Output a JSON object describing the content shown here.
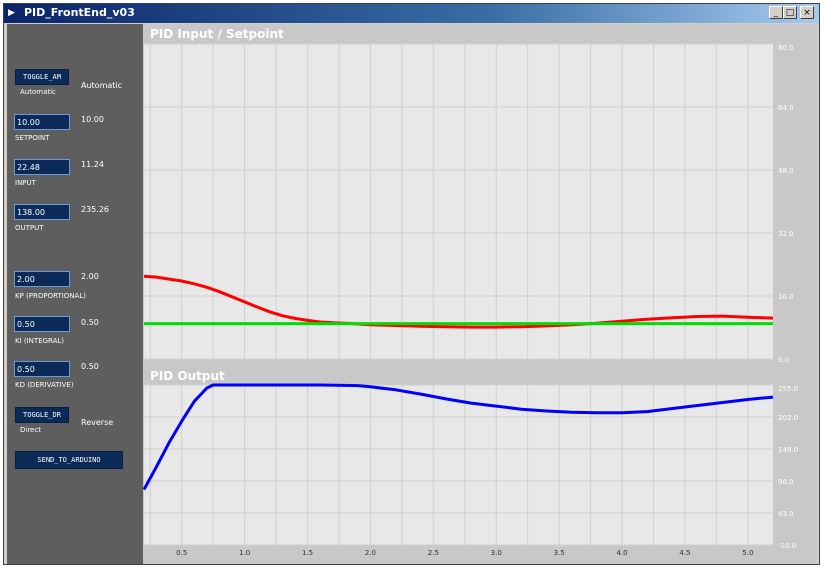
{
  "window": {
    "title": "PID_FrontEnd_v03",
    "minimize": "_",
    "maximize": "□",
    "close": "×"
  },
  "panel": {
    "am": {
      "button": "TOGGLE_AM",
      "label": "Automatic",
      "value": "Automatic"
    },
    "setpoint": {
      "field": "10.00",
      "label": "SETPOINT",
      "value": "10.00"
    },
    "input": {
      "field": "22.48",
      "label": "INPUT",
      "value": "11.24"
    },
    "output": {
      "field": "138.00",
      "label": "OUTPUT",
      "value": "235.26"
    },
    "kp": {
      "field": "2.00",
      "label": "KP (PROPORTIONAL)",
      "value": "2.00"
    },
    "ki": {
      "field": "0.50",
      "label": "KI (INTEGRAL)",
      "value": "0.50"
    },
    "kd": {
      "field": "0.50",
      "label": "KD (DERIVATIVE)",
      "value": "0.50"
    },
    "dr": {
      "button": "TOGGLE_DR",
      "label": "Direct",
      "value": "Reverse"
    },
    "send": "SEND_TO_ARDUINO"
  },
  "colors": {
    "input": "#ff0000",
    "setpoint": "#00dd00",
    "output": "#0000ff"
  },
  "chart_data": [
    {
      "type": "line",
      "title": "PID Input / Setpoint",
      "ylim": [
        0,
        80
      ],
      "yticks": [
        "0.0",
        "16.0",
        "32.0",
        "48.0",
        "64.0",
        "80.0"
      ],
      "xlim": [
        0.2,
        5.2
      ],
      "xticks": [],
      "grid": true,
      "series": [
        {
          "id": "input",
          "x": [
            0.2,
            0.3,
            0.4,
            0.5,
            0.6,
            0.7,
            0.8,
            0.9,
            1.0,
            1.1,
            1.2,
            1.3,
            1.4,
            1.5,
            1.6,
            1.7,
            1.8,
            1.9,
            2.0,
            2.2,
            2.4,
            2.6,
            2.8,
            3.0,
            3.2,
            3.4,
            3.6,
            3.8,
            4.0,
            4.2,
            4.4,
            4.6,
            4.8,
            5.0,
            5.2
          ],
          "y": [
            21,
            20.8,
            20.3,
            19.8,
            19.1,
            18.2,
            17.1,
            15.8,
            14.5,
            13.2,
            12,
            11,
            10.3,
            9.8,
            9.4,
            9.2,
            9.1,
            8.9,
            8.7,
            8.5,
            8.3,
            8.2,
            8.1,
            8.1,
            8.2,
            8.4,
            8.7,
            9.1,
            9.6,
            10.1,
            10.5,
            10.8,
            10.9,
            10.6,
            10.4
          ]
        },
        {
          "id": "setpoint",
          "x": [
            0.2,
            5.2
          ],
          "y": [
            9,
            9
          ]
        }
      ]
    },
    {
      "type": "line",
      "title": "PID Output",
      "ylim": [
        -10,
        255
      ],
      "yticks": [
        "-10.0",
        "43.0",
        "96.0",
        "149.0",
        "202.0",
        "255.0"
      ],
      "xlim": [
        0.2,
        5.2
      ],
      "xticks": [
        "0.5",
        "1.0",
        "1.5",
        "2.0",
        "2.5",
        "3.0",
        "3.5",
        "4.0",
        "4.5",
        "5.0"
      ],
      "grid": true,
      "series": [
        {
          "id": "output",
          "x": [
            0.2,
            0.3,
            0.4,
            0.5,
            0.6,
            0.7,
            0.75,
            1.0,
            1.3,
            1.6,
            1.9,
            2.0,
            2.2,
            2.4,
            2.6,
            2.8,
            3.0,
            3.2,
            3.4,
            3.6,
            3.8,
            4.0,
            4.2,
            4.4,
            4.6,
            4.8,
            5.0,
            5.2
          ],
          "y": [
            82,
            120,
            160,
            195,
            228,
            250,
            255,
            255,
            255,
            255,
            254,
            252,
            247,
            240,
            232,
            225,
            220,
            215,
            212,
            210,
            209,
            209,
            211,
            216,
            221,
            226,
            231,
            235
          ]
        }
      ]
    }
  ]
}
